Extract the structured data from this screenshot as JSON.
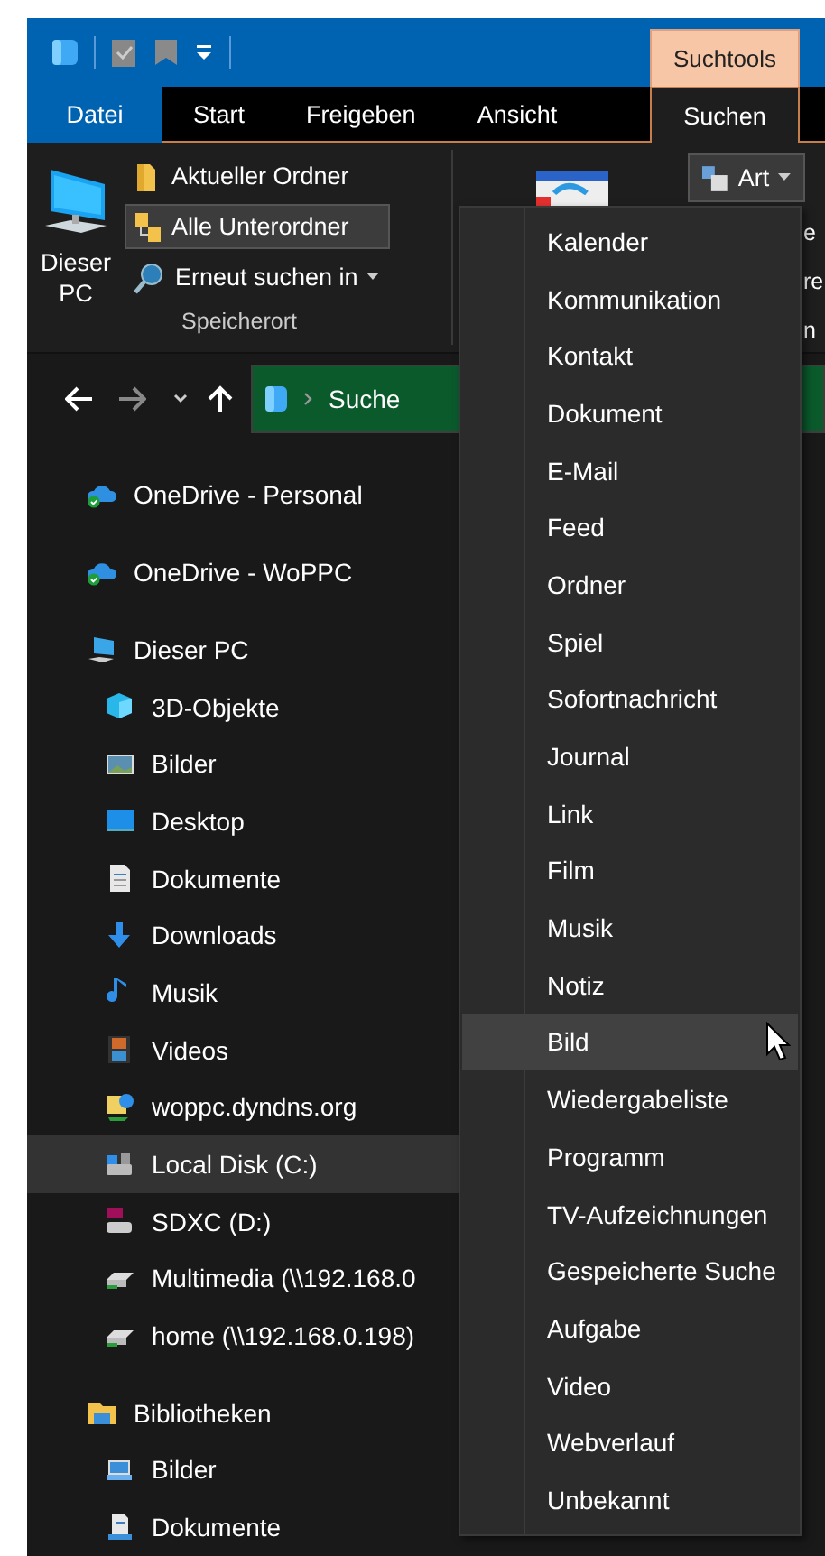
{
  "contextual_tab_group": {
    "label": "Suchtools"
  },
  "tabs": [
    {
      "label": "Datei",
      "kind": "file",
      "selected": false
    },
    {
      "label": "Start",
      "kind": "tab",
      "selected": false
    },
    {
      "label": "Freigeben",
      "kind": "tab",
      "selected": false
    },
    {
      "label": "Ansicht",
      "kind": "tab",
      "selected": false
    },
    {
      "label": "Suchen",
      "kind": "tab",
      "selected": true
    }
  ],
  "ribbon": {
    "location_group": {
      "label": "Speicherort",
      "large_button": "Dieser PC",
      "buttons": [
        {
          "label": "Aktueller Ordner",
          "selected": false,
          "dropdown": false
        },
        {
          "label": "Alle Unterordner",
          "selected": true,
          "dropdown": false
        },
        {
          "label": "Erneut suchen in",
          "selected": false,
          "dropdown": true
        }
      ]
    },
    "type_button": {
      "label": "Art"
    },
    "label_fragments": [
      "e",
      "re",
      "n"
    ]
  },
  "address_bar": {
    "path": "Suche"
  },
  "navigation_pane": {
    "items": [
      {
        "label": "OneDrive - Personal",
        "kind": "cloud",
        "selected": false
      },
      {
        "label": "OneDrive - WoPPC",
        "kind": "cloud",
        "selected": false
      },
      {
        "label": "Dieser PC",
        "kind": "computer",
        "selected": false,
        "children": [
          {
            "label": "3D-Objekte",
            "kind": "cube",
            "selected": false
          },
          {
            "label": "Bilder",
            "kind": "pictures",
            "selected": false
          },
          {
            "label": "Desktop",
            "kind": "desktop",
            "selected": false
          },
          {
            "label": "Dokumente",
            "kind": "document",
            "selected": false
          },
          {
            "label": "Downloads",
            "kind": "download",
            "selected": false
          },
          {
            "label": "Musik",
            "kind": "music",
            "selected": false
          },
          {
            "label": "Videos",
            "kind": "video",
            "selected": false
          },
          {
            "label": "woppc.dyndns.org",
            "kind": "network",
            "selected": false
          },
          {
            "label": "Local Disk (C:)",
            "kind": "drive",
            "selected": true
          },
          {
            "label": "SDXC (D:)",
            "kind": "sdcard",
            "selected": false
          },
          {
            "label": "Multimedia (\\\\192.168.0",
            "kind": "netdrive",
            "selected": false
          },
          {
            "label": "home (\\\\192.168.0.198)",
            "kind": "netdrive",
            "selected": false
          }
        ]
      },
      {
        "label": "Bibliotheken",
        "kind": "library",
        "selected": false,
        "children": [
          {
            "label": "Bilder",
            "kind": "picturelib",
            "selected": false
          },
          {
            "label": "Dokumente",
            "kind": "doclib",
            "selected": false
          }
        ]
      }
    ]
  },
  "type_menu": {
    "items": [
      {
        "label": "Kalender",
        "selected": false
      },
      {
        "label": "Kommunikation",
        "selected": false
      },
      {
        "label": "Kontakt",
        "selected": false
      },
      {
        "label": "Dokument",
        "selected": false
      },
      {
        "label": "E-Mail",
        "selected": false
      },
      {
        "label": "Feed",
        "selected": false
      },
      {
        "label": "Ordner",
        "selected": false
      },
      {
        "label": "Spiel",
        "selected": false
      },
      {
        "label": "Sofortnachricht",
        "selected": false
      },
      {
        "label": "Journal",
        "selected": false
      },
      {
        "label": "Link",
        "selected": false
      },
      {
        "label": "Film",
        "selected": false
      },
      {
        "label": "Musik",
        "selected": false
      },
      {
        "label": "Notiz",
        "selected": false
      },
      {
        "label": "Bild",
        "selected": true
      },
      {
        "label": "Wiedergabeliste",
        "selected": false
      },
      {
        "label": "Programm",
        "selected": false
      },
      {
        "label": "TV-Aufzeichnungen",
        "selected": false
      },
      {
        "label": "Gespeicherte Suche",
        "selected": false
      },
      {
        "label": "Aufgabe",
        "selected": false
      },
      {
        "label": "Video",
        "selected": false
      },
      {
        "label": "Webverlauf",
        "selected": false
      },
      {
        "label": "Unbekannt",
        "selected": false
      }
    ]
  }
}
